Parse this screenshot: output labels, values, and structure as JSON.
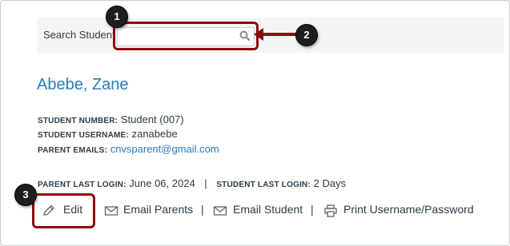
{
  "search": {
    "label": "Search Students",
    "label_visible": "Search Student",
    "value": "",
    "icon": "magnifier-icon"
  },
  "callouts": {
    "one": "1",
    "two": "2",
    "three": "3"
  },
  "student": {
    "name": "Abebe, Zane",
    "number_label": "STUDENT NUMBER:",
    "number_value": "Student (007)",
    "username_label": "STUDENT USERNAME:",
    "username_value": "zanabebe",
    "parent_emails_label": "PARENT EMAILS:",
    "parent_emails_value": "cnvsparent@gmail.com",
    "parent_login_label": "PARENT LAST LOGIN:",
    "parent_login_value": "June 06, 2024",
    "separator": "|",
    "student_login_label": "STUDENT LAST LOGIN:",
    "student_login_value": "2 Days"
  },
  "actions": {
    "edit": "Edit",
    "email_parents": "Email Parents",
    "email_student": "Email Student",
    "print": "Print Username/Password",
    "separator": "|"
  },
  "colors": {
    "callout": "#8b0d0d",
    "link": "#2b7abc",
    "text": "#2d3b45"
  }
}
